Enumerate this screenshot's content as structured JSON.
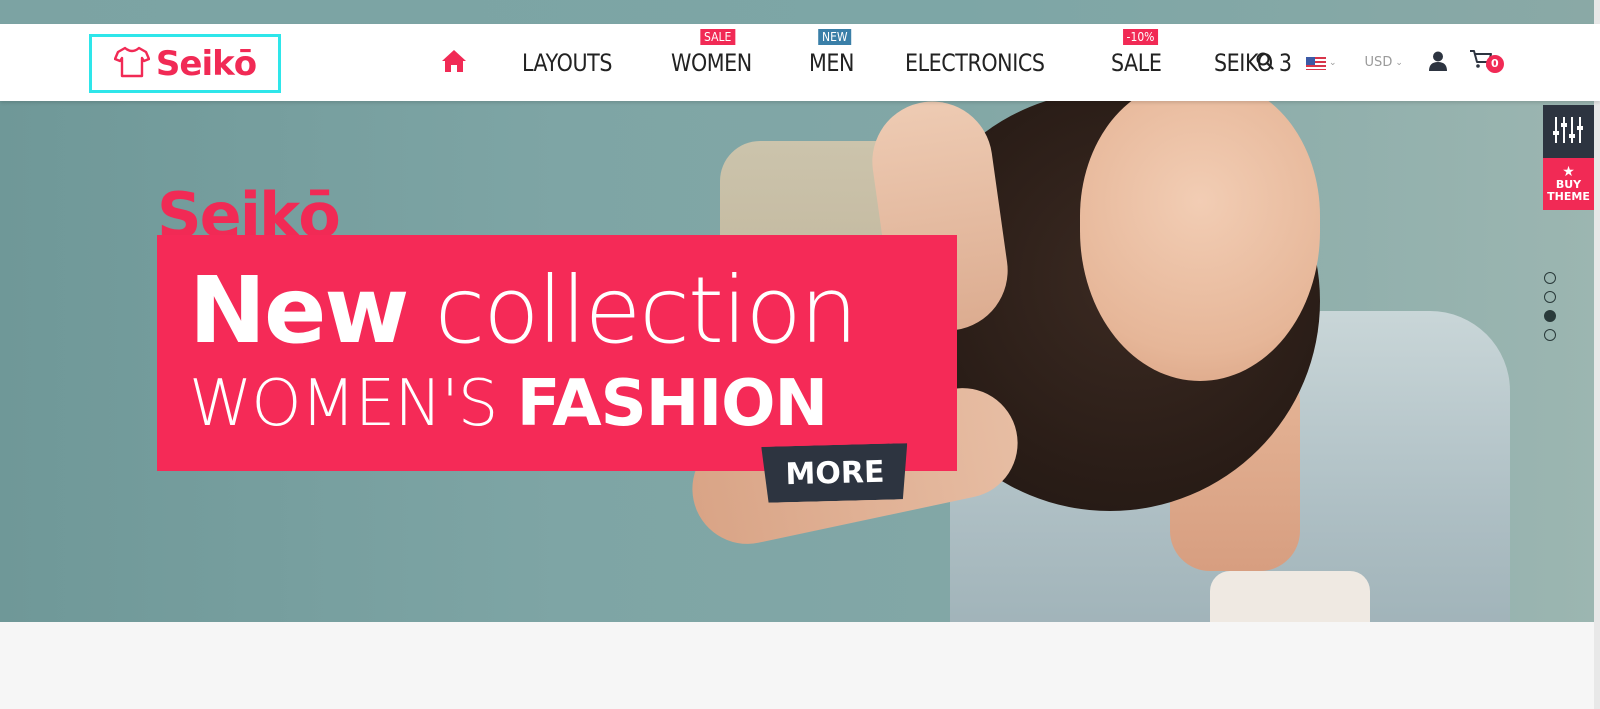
{
  "header": {
    "brand": "Seikō",
    "nav": [
      {
        "label": "LAYOUTS",
        "badge": ""
      },
      {
        "label": "WOMEN",
        "badge": "SALE"
      },
      {
        "label": "MEN",
        "badge": "NEW"
      },
      {
        "label": "ELECTRONICS",
        "badge": ""
      },
      {
        "label": "SALE",
        "badge": "-10%"
      },
      {
        "label": "SEIKO 3",
        "badge": ""
      }
    ],
    "currency": "USD",
    "cart_count": "0"
  },
  "hero": {
    "brand": "Seikō",
    "line1_bold": "New",
    "line1_thin": "collection",
    "line2_thin": "WOMEN'S",
    "line2_bold": "FASHION",
    "more_label": "MORE"
  },
  "side": {
    "buy_label": "BUY THEME"
  },
  "slider": {
    "total": 4,
    "active_index": 2
  },
  "colors": {
    "accent": "#f12a55",
    "dark": "#2d3440",
    "badge_new": "#3a7fa8",
    "logo_outline": "#2ee6ea"
  }
}
